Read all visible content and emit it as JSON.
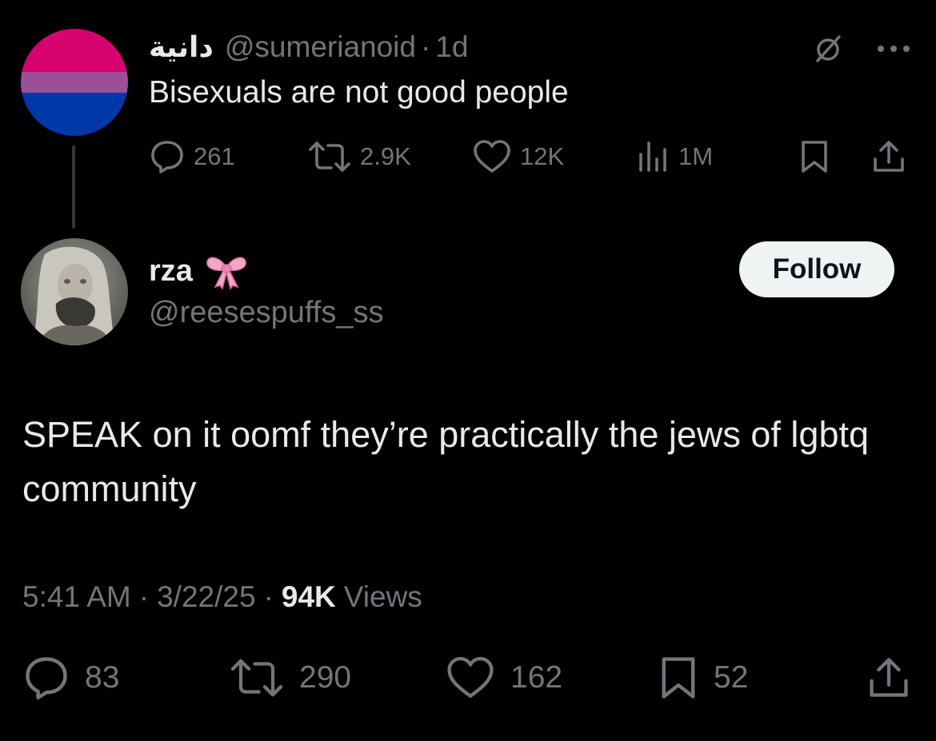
{
  "parent_tweet": {
    "display_name": "دانية",
    "handle": "@sumerianoid",
    "separator": "·",
    "time_ago": "1d",
    "text": "Bisexuals are not good people",
    "avatar_colors": [
      "#d60270",
      "#9b4f96",
      "#0038a8"
    ],
    "actions": {
      "replies": "261",
      "reposts": "2.9K",
      "likes": "12K",
      "views": "1M"
    },
    "icons": [
      "grok-icon",
      "more-icon",
      "reply-icon",
      "repost-icon",
      "like-icon",
      "views-icon",
      "bookmark-icon",
      "share-icon"
    ]
  },
  "main_tweet": {
    "display_name": "rza",
    "name_emoji": "ribbon-bow",
    "handle": "@reesespuffs_ss",
    "follow_label": "Follow",
    "text": "SPEAK on it oomf they’re practically the jews of lgbtq community",
    "timestamp_time": "5:41 AM",
    "separator": "·",
    "timestamp_date": "3/22/25",
    "views_count": "94K",
    "views_label": "Views",
    "actions": {
      "replies": "83",
      "reposts": "290",
      "likes": "162",
      "bookmarks": "52"
    }
  },
  "colors": {
    "background": "#000000",
    "text_primary": "#e7e9ea",
    "text_secondary": "#71767b",
    "follow_button_bg": "#eff3f4",
    "follow_button_text": "#0f1419",
    "thread_line": "#333639",
    "bow_pink": "#f4a6c9"
  }
}
